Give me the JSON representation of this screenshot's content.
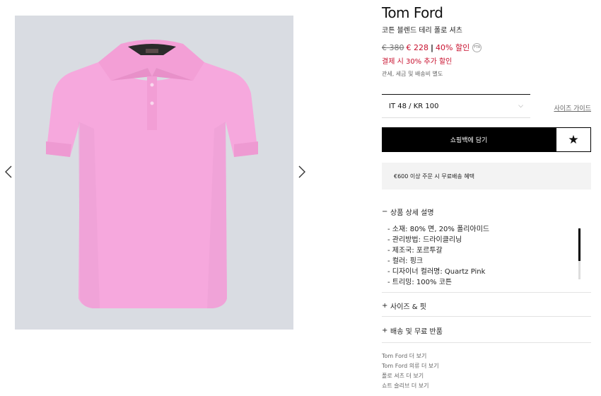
{
  "product": {
    "brand": "Tom Ford",
    "name": "코튼 블렌드 테리 폴로 셔츠",
    "image_alt": "Pink cotton blend terry polo shirt"
  },
  "price": {
    "original": "€ 380",
    "current": "€ 228",
    "separator": "|",
    "discount": "40% 할인",
    "badge": "FTA",
    "extra_discount": "결제 시 30% 추가 할인",
    "duty_note": "관세, 세금 및 배송비 별도"
  },
  "size": {
    "selected": "IT 48 / KR 100",
    "guide_label": "사이즈 가이드"
  },
  "actions": {
    "add_to_bag": "쇼핑백에 담기"
  },
  "shipping_banner": "€600 이상 주문 시 무료배송 혜택",
  "accordion": {
    "details": {
      "sign": "−",
      "label": "상품 상세 설명",
      "items": [
        "- 소재: 80% 면, 20% 폴리아미드",
        "- 관리방법: 드라이클리닝",
        "- 제조국: 포르투갈",
        "- 컬러: 핑크",
        "- 디자이너 컬러명: Quartz Pink",
        "- 트리밍: 100% 코튼"
      ]
    },
    "size_fit": {
      "sign": "+",
      "label": "사이즈 & 핏"
    },
    "shipping": {
      "sign": "+",
      "label": "배송 및 무료 반품"
    }
  },
  "more_links": [
    "Tom Ford 더 보기",
    "Tom Ford 의류 더 보기",
    "폴로 셔츠 더 보기",
    "쇼트 슬리브 더 보기"
  ],
  "colors": {
    "shirt": "#f6a8dd",
    "background": "#d9dce2",
    "sale": "#c8102e"
  }
}
